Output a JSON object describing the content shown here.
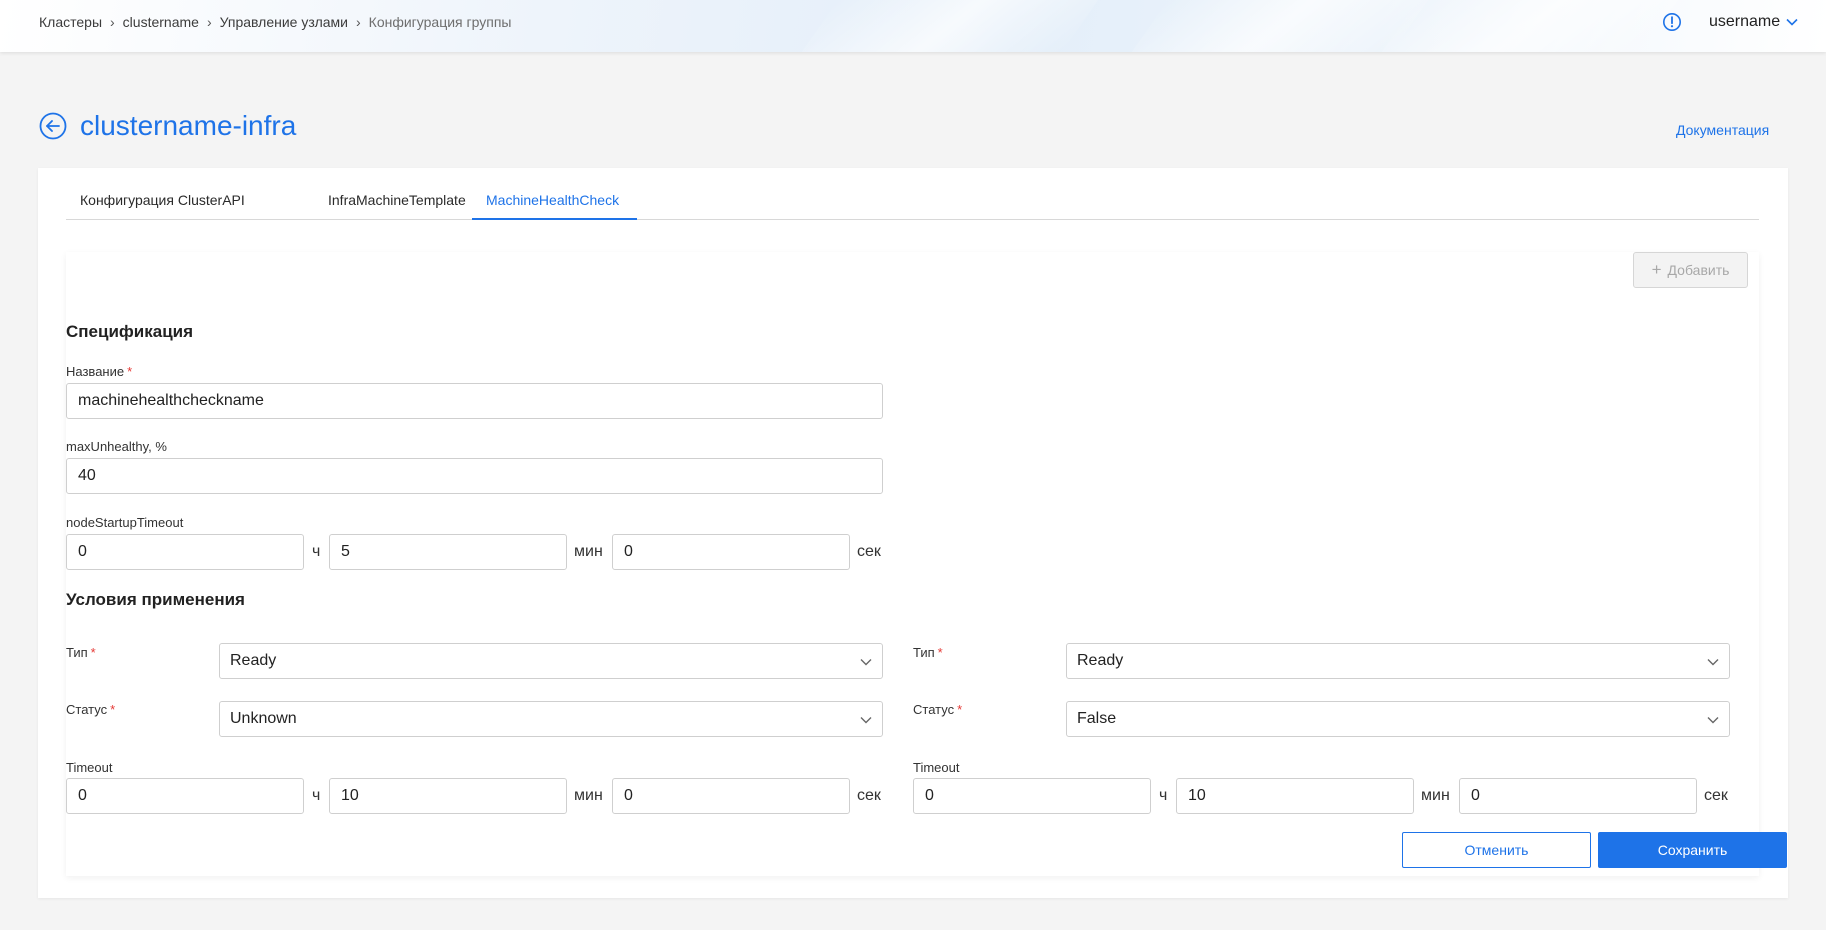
{
  "header": {
    "breadcrumbs": [
      "Кластеры",
      "clustername",
      "Управление узлами",
      "Конфигурация группы"
    ],
    "username": "username",
    "icons": {
      "info": "info-icon",
      "user_menu": "chevron-down-icon",
      "crumb_sep": "chevron-right-icon"
    }
  },
  "page": {
    "title": "clustername-infra",
    "back_icon": "arrow-left-circle-icon",
    "doc_link": "Документация"
  },
  "tabs": [
    {
      "label": "Конфигурация ClusterAPI",
      "active": false
    },
    {
      "label": "InfraMachineTemplate",
      "active": false
    },
    {
      "label": "MachineHealthCheck",
      "active": true
    }
  ],
  "toolbar": {
    "add_label": "Добавить",
    "add_icon": "plus-icon"
  },
  "spec": {
    "section_title": "Спецификация",
    "name_label": "Название",
    "name_value": "machinehealthcheckname",
    "max_unhealthy_label": "maxUnhealthy, %",
    "max_unhealthy_value": "40",
    "startup_timeout_label": "nodeStartupTimeout",
    "startup_timeout": {
      "hours": "0",
      "minutes": "5",
      "seconds": "0"
    }
  },
  "units": {
    "h": "ч",
    "m": "мин",
    "s": "сек"
  },
  "conditions": {
    "section_title": "Условия применения",
    "type_label": "Тип",
    "status_label": "Статус",
    "timeout_label": "Timeout",
    "items": [
      {
        "type": "Ready",
        "status": "Unknown",
        "timeout": {
          "hours": "0",
          "minutes": "10",
          "seconds": "0"
        }
      },
      {
        "type": "Ready",
        "status": "False",
        "timeout": {
          "hours": "0",
          "minutes": "10",
          "seconds": "0"
        }
      }
    ]
  },
  "actions": {
    "cancel": "Отменить",
    "save": "Сохранить"
  },
  "colors": {
    "accent": "#1e73e8",
    "required": "#e53935"
  }
}
